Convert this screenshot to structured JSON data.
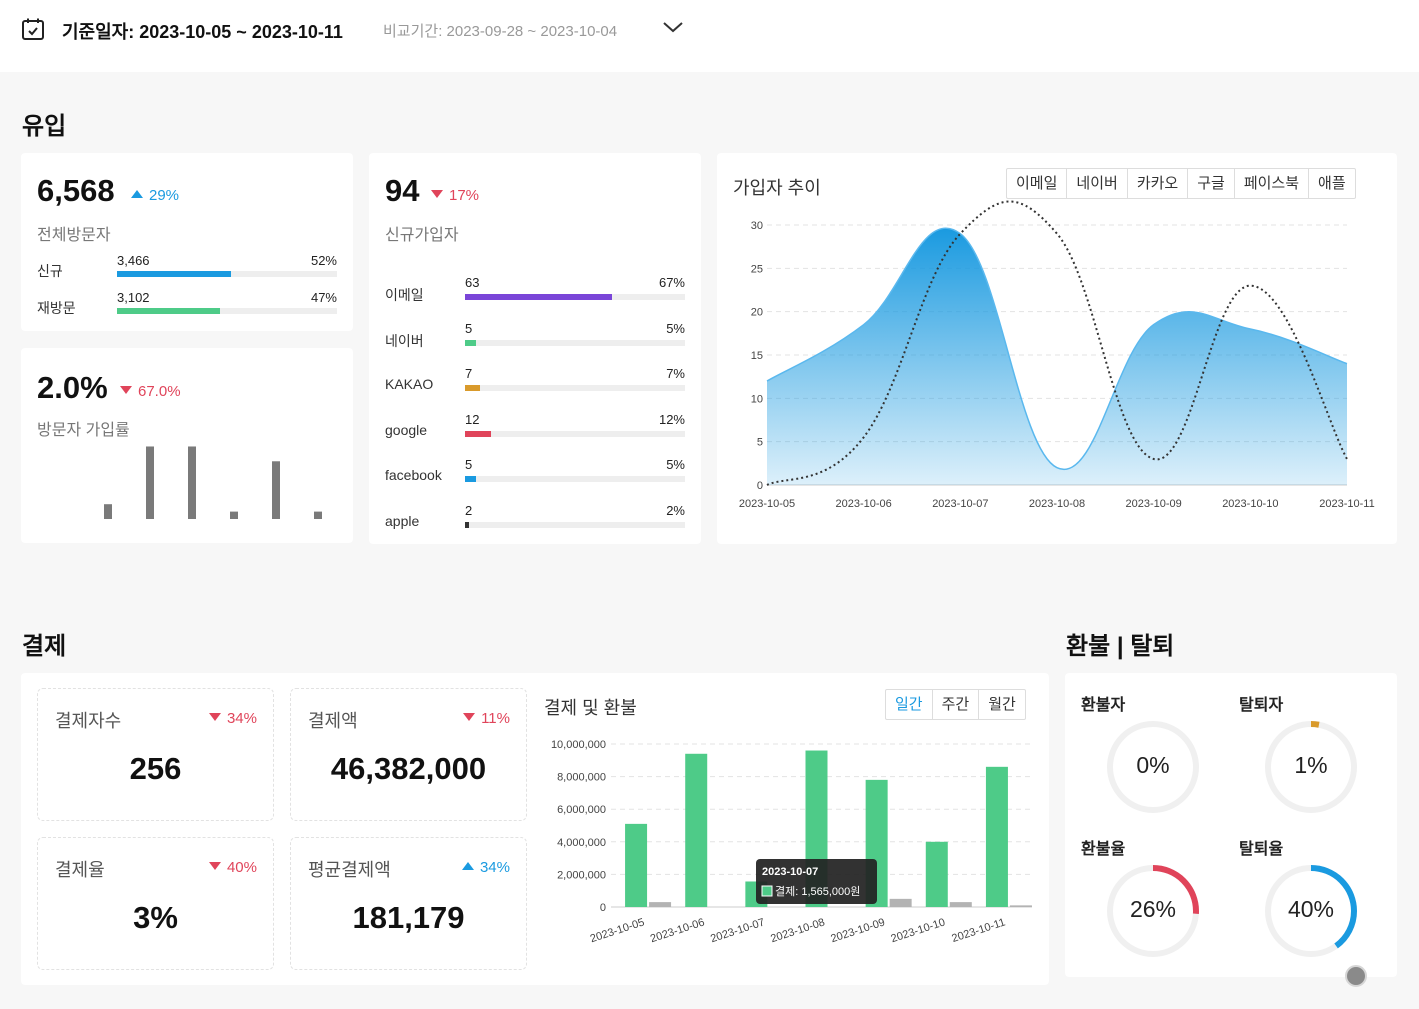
{
  "header": {
    "date_range": "기준일자: 2023-10-05 ~ 2023-10-11",
    "compare_range": "비교기간: 2023-09-28 ~ 2023-10-04"
  },
  "inflow": {
    "title": "유입",
    "visitors": {
      "value": "6,568",
      "delta": "29%",
      "label": "전체방문자",
      "rows": [
        {
          "label": "신규",
          "count": "3,466",
          "pct": "52%",
          "fraction": 0.52,
          "color": "#1a9ae0"
        },
        {
          "label": "재방문",
          "count": "3,102",
          "pct": "47%",
          "fraction": 0.47,
          "color": "#4ecb88"
        }
      ]
    },
    "conversion": {
      "value": "2.0%",
      "delta": "67.0%",
      "label": "방문자 가입률",
      "sparkline": [
        0.2,
        0.98,
        0.98,
        0.1,
        0.78,
        0.1
      ]
    },
    "signups": {
      "value": "94",
      "delta": "17%",
      "label": "신규가입자",
      "rows": [
        {
          "label": "이메일",
          "count": "63",
          "pct": "67%",
          "fraction": 0.67,
          "color": "#7a45d8"
        },
        {
          "label": "네이버",
          "count": "5",
          "pct": "5%",
          "fraction": 0.05,
          "color": "#4ecb88"
        },
        {
          "label": "KAKAO",
          "count": "7",
          "pct": "7%",
          "fraction": 0.07,
          "color": "#d99a2b"
        },
        {
          "label": "google",
          "count": "12",
          "pct": "12%",
          "fraction": 0.12,
          "color": "#e0445a"
        },
        {
          "label": "facebook",
          "count": "5",
          "pct": "5%",
          "fraction": 0.05,
          "color": "#1a9ae0"
        },
        {
          "label": "apple",
          "count": "2",
          "pct": "2%",
          "fraction": 0.02,
          "color": "#333333"
        }
      ]
    },
    "trend": {
      "title": "가입자 추이",
      "tabs": [
        "이메일",
        "네이버",
        "카카오",
        "구글",
        "페이스북",
        "애플"
      ]
    }
  },
  "payment": {
    "title": "결제",
    "kpis": [
      {
        "label": "결제자수",
        "delta": "34%",
        "direction": "down",
        "value": "256"
      },
      {
        "label": "결제액",
        "delta": "11%",
        "direction": "down",
        "value": "46,382,000"
      },
      {
        "label": "결제율",
        "delta": "40%",
        "direction": "down",
        "value": "3%"
      },
      {
        "label": "평균결제액",
        "delta": "34%",
        "direction": "up",
        "value": "181,179"
      }
    ],
    "chart": {
      "title": "결제 및 환불",
      "tabs": [
        "일간",
        "주간",
        "월간"
      ],
      "active_tab": "일간",
      "tooltip": {
        "date": "2023-10-07",
        "text": "결제: 1,565,000원"
      }
    }
  },
  "refund": {
    "title": "환불 | 탈퇴",
    "donuts": [
      {
        "label": "환불자",
        "value": "0%",
        "fraction": 0.0,
        "color": "#e0445a"
      },
      {
        "label": "탈퇴자",
        "value": "1%",
        "fraction": 0.01,
        "color": "#d99a2b"
      },
      {
        "label": "환불율",
        "value": "26%",
        "fraction": 0.26,
        "color": "#e0445a"
      },
      {
        "label": "탈퇴율",
        "value": "40%",
        "fraction": 0.4,
        "color": "#1a9ae0"
      }
    ]
  },
  "chart_data": [
    {
      "type": "area",
      "title": "가입자 추이",
      "categories": [
        "2023-10-05",
        "2023-10-06",
        "2023-10-07",
        "2023-10-08",
        "2023-10-09",
        "2023-10-10",
        "2023-10-11"
      ],
      "ylim": [
        0,
        30
      ],
      "yticks": [
        0,
        5,
        10,
        15,
        20,
        25,
        30
      ],
      "grid": true,
      "series": [
        {
          "values": [
            12,
            18.5,
            29,
            2,
            18.5,
            18,
            14
          ],
          "color": "#1a9ae0",
          "style": "area"
        },
        {
          "values": [
            0,
            5.5,
            29,
            29,
            3,
            23,
            3
          ],
          "color": "#333333",
          "style": "dotted"
        }
      ]
    },
    {
      "type": "bar",
      "title": "결제 및 환불",
      "categories": [
        "2023-10-05",
        "2023-10-06",
        "2023-10-07",
        "2023-10-08",
        "2023-10-09",
        "2023-10-10",
        "2023-10-11"
      ],
      "ylim": [
        0,
        10000000
      ],
      "yticks": [
        "0",
        "2,000,000",
        "4,000,000",
        "6,000,000",
        "8,000,000",
        "10,000,000"
      ],
      "grid": true,
      "series": [
        {
          "name": "결제",
          "values": [
            5100000,
            9400000,
            1565000,
            9600000,
            7800000,
            4000000,
            8600000
          ],
          "color": "#4ecb88"
        },
        {
          "values": [
            300000,
            0,
            0,
            0,
            500000,
            300000,
            100000
          ],
          "color": "#b3b3b3"
        }
      ]
    }
  ]
}
